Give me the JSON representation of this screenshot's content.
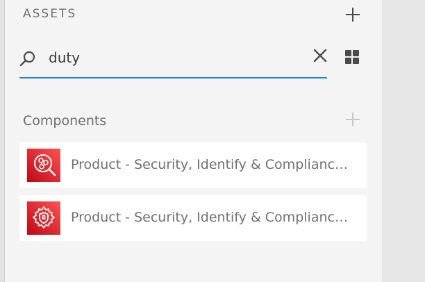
{
  "panel": {
    "title": "ASSETS",
    "add_icon": "plus-icon"
  },
  "search": {
    "value": "duty",
    "search_icon": "search-icon",
    "clear_icon": "close-icon",
    "view_icon": "grid-view-icon",
    "accent_color": "#2680eb"
  },
  "components": {
    "heading": "Components",
    "add_icon": "plus-icon",
    "items": [
      {
        "label": "Product - Security, Identify & Compliance - Amazon GuardDuty",
        "visible_label": "Product - Security, Identify & Complianc…",
        "icon": "guardduty-icon",
        "icon_color": "#dd344c"
      },
      {
        "label": "Product - Security, Identify & Compliance",
        "visible_label": "Product - Security, Identify & Complianc…",
        "icon": "gear-shield-icon",
        "icon_color": "#dd344c"
      }
    ]
  }
}
